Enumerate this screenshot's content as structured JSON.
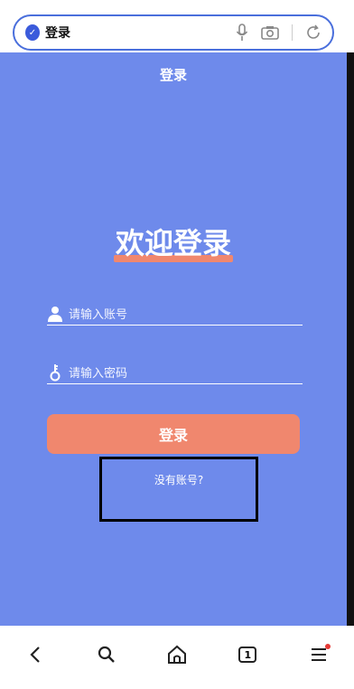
{
  "browser": {
    "address_text": "登录"
  },
  "page": {
    "header_title": "登录",
    "welcome": "欢迎登录",
    "account_placeholder": "请输入账号",
    "password_placeholder": "请输入密码",
    "login_button": "登录",
    "no_account": "没有账号?"
  },
  "bottom_nav": {
    "tab_count": "1"
  },
  "colors": {
    "page_bg": "#6e8aeb",
    "accent": "#f0876e",
    "address_border": "#4a6fdc"
  }
}
